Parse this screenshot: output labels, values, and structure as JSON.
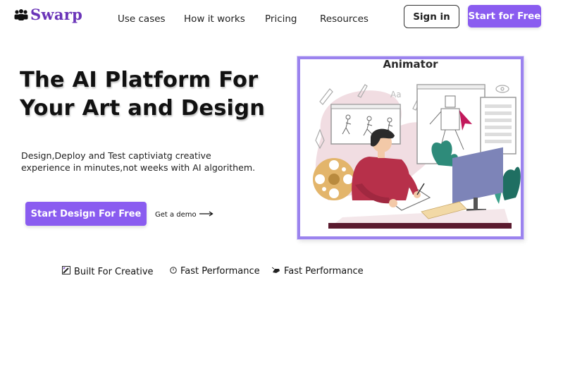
{
  "brand": {
    "name": "Swarp",
    "color": "#6a34b8",
    "logo_icon": "people-group-icon"
  },
  "nav": {
    "links": [
      "Use cases",
      "How it works",
      "Pricing",
      "Resources"
    ],
    "signin_label": "Sign in",
    "start_label": "Start for Free"
  },
  "hero": {
    "title_line1": "The AI Platform For",
    "title_line2": "Your Art and Design",
    "subtitle_line1": "Design,Deploy and Test captiviatg creative",
    "subtitle_line2": "experience in minutes,not weeks with AI algorithem.",
    "cta_label": "Start Design For Free",
    "demo_label": "Get a demo",
    "demo_icon": "arrow-right-icon"
  },
  "illustration": {
    "title": "Animator",
    "description": "woman-drawing-on-tablet-animator-illustration"
  },
  "features": [
    {
      "icon": "pencil-square-icon",
      "label": "Built For Creative"
    },
    {
      "icon": "clock-icon",
      "label": "Fast Performance"
    },
    {
      "icon": "rocket-icon",
      "label": "Fast Performance"
    }
  ],
  "colors": {
    "accent": "#8a5cf0",
    "frame": "#9b83ee",
    "text": "#111111"
  }
}
